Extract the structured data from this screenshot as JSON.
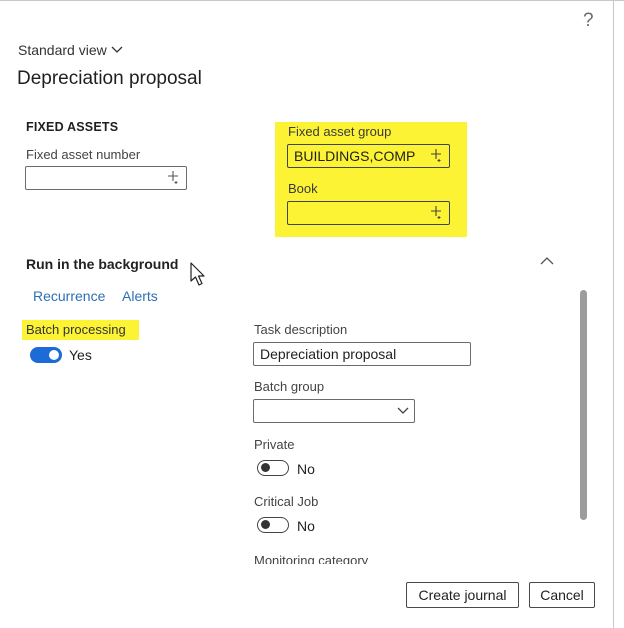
{
  "header": {
    "help_glyph": "?",
    "view_label": "Standard view",
    "title": "Depreciation proposal"
  },
  "fixed_assets": {
    "section_title": "FIXED ASSETS",
    "fixed_asset_number_label": "Fixed asset number",
    "fixed_asset_number_value": "",
    "fixed_asset_group_label": "Fixed asset group",
    "fixed_asset_group_value": "BUILDINGS,COMP",
    "book_label": "Book",
    "book_value": ""
  },
  "background": {
    "heading": "Run in the background",
    "links": {
      "recurrence": "Recurrence",
      "alerts": "Alerts"
    },
    "batch_processing_label": "Batch processing",
    "batch_processing_value": "Yes",
    "task_description_label": "Task description",
    "task_description_value": "Depreciation proposal",
    "batch_group_label": "Batch group",
    "batch_group_value": "",
    "private_label": "Private",
    "private_value": "No",
    "critical_job_label": "Critical Job",
    "critical_job_value": "No",
    "monitoring_category_label": "Monitoring category"
  },
  "footer": {
    "create_journal_label": "Create journal",
    "cancel_label": "Cancel"
  },
  "colors": {
    "highlight": "#fdf335",
    "link": "#2d6fb3",
    "toggle_on": "#1d6bd6"
  },
  "toggles": {
    "batch_processing_on": true,
    "private_on": false,
    "critical_job_on": false
  }
}
